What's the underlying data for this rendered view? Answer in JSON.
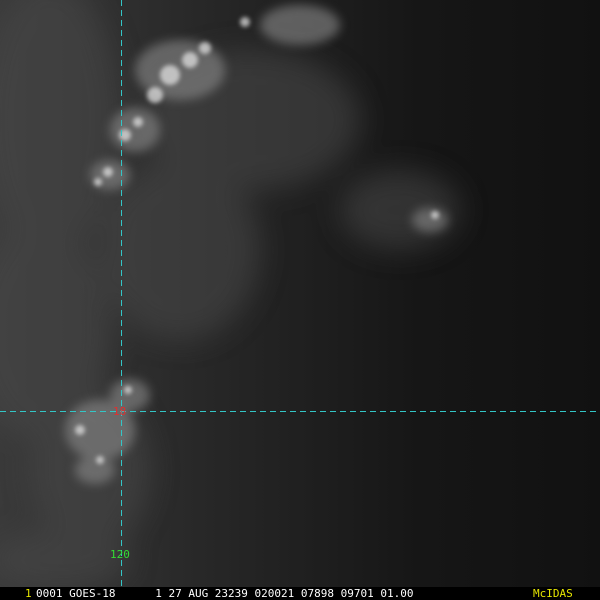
{
  "image": {
    "status": {
      "frame_number": "1",
      "text": "0001 GOES-18      1 27 AUG 23239 020021 07898 09701 01.00",
      "brand": "McIDAS"
    },
    "grid": {
      "latitude_label": "18",
      "longitude_label": "120",
      "line_color": "#33c6c6",
      "latitude_label_color": "#e03030",
      "longitude_label_color": "#33dd33"
    },
    "colors": {
      "frame_number": "#e6e600",
      "status_text": "#ffffff",
      "brand": "#e6e600",
      "ocean": "#161616",
      "cloud": "#d8d8d8"
    }
  }
}
